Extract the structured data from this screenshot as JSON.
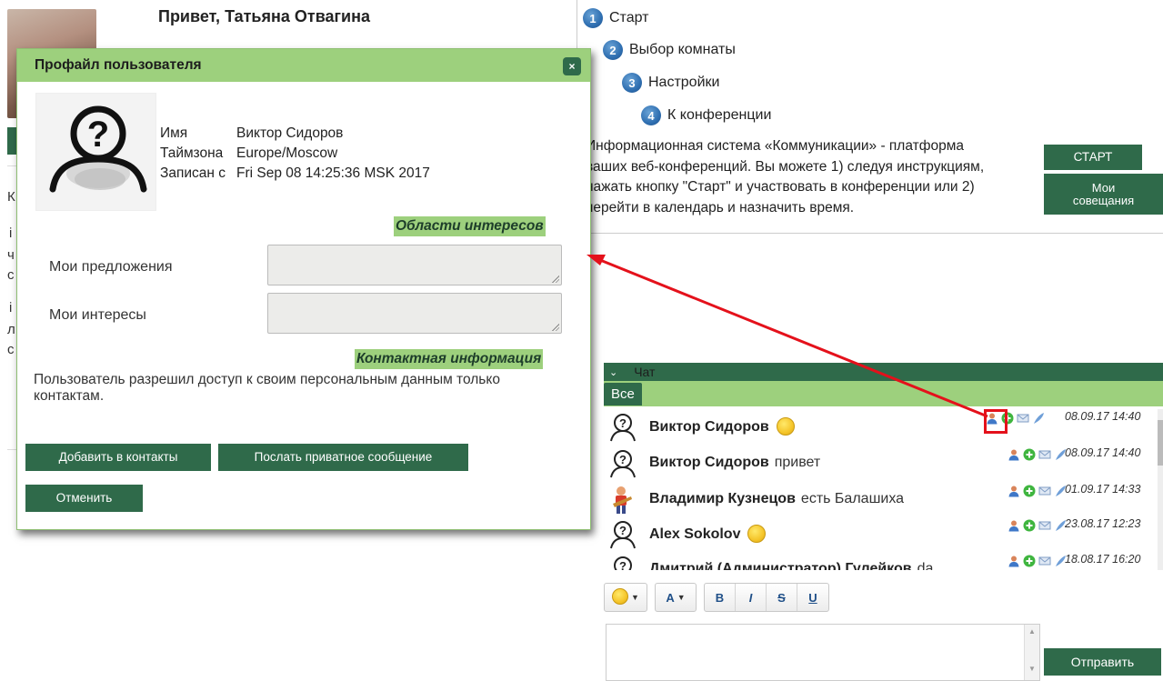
{
  "header": {
    "greeting": "Привет, Татьяна Отвагина"
  },
  "steps": [
    {
      "num": "1",
      "label": "Старт"
    },
    {
      "num": "2",
      "label": "Выбор комнаты"
    },
    {
      "num": "3",
      "label": "Настройки"
    },
    {
      "num": "4",
      "label": "К конференции"
    }
  ],
  "info": {
    "lines": [
      "Информационная система «Коммуникации» - платформа",
      "ваших веб-конференций. Вы можете 1) следуя инструкциям,",
      "нажать кнопку \"Старт\" и участвовать в конференции или 2)",
      "перейти в календарь и назначить время."
    ]
  },
  "buttons": {
    "start": "СТАРТ",
    "my_meetings": "Мои совещания"
  },
  "chat": {
    "title": "Чат",
    "tab_all": "Все",
    "messages": [
      {
        "author": "Виктор Сидоров",
        "text": "",
        "smiley": true,
        "time": "08.09.17 14:40",
        "avatar": "question-avatar"
      },
      {
        "author": "Виктор Сидоров",
        "text": "привет",
        "smiley": false,
        "time": "08.09.17 14:40",
        "avatar": "question-avatar"
      },
      {
        "author": "Владимир Кузнецов",
        "text": "есть Балашиха",
        "smiley": false,
        "time": "01.09.17 14:33",
        "avatar": "musician-avatar"
      },
      {
        "author": "Alex Sokolov",
        "text": "",
        "smiley": true,
        "time": "23.08.17 12:23",
        "avatar": "question-avatar"
      },
      {
        "author": "Дмитрий (Администратор) Гулейков",
        "text": "da",
        "smiley": false,
        "time": "18.08.17 16:20",
        "avatar": "question-avatar"
      }
    ],
    "toolbar": {
      "font": "A",
      "bold": "B",
      "italic": "I",
      "strike": "S",
      "underline": "U"
    },
    "send": "Отправить"
  },
  "modal": {
    "title": "Профайл пользователя",
    "close": "×",
    "name_label": "Имя",
    "name_value": "Виктор Сидоров",
    "tz_label": "Таймзона",
    "tz_value": "Europe/Moscow",
    "since_label": "Записан с",
    "since_value": "Fri Sep 08 14:25:36 MSK 2017",
    "interests_header": "Области интересов",
    "proposals_label": "Мои предложения",
    "interests_label": "Мои интересы",
    "contact_header": "Контактная информация",
    "contact_text": "Пользователь разрешил доступ к своим персональным данным только контактам.",
    "add_contact": "Добавить в контакты",
    "private_msg": "Послать приватное сообщение",
    "cancel": "Отменить"
  },
  "colors": {
    "accent_dark_green": "#2f6a4a",
    "light_green": "#9dd07d",
    "annotation_red": "#e4111b",
    "step_blue": "#2f6fb1"
  }
}
